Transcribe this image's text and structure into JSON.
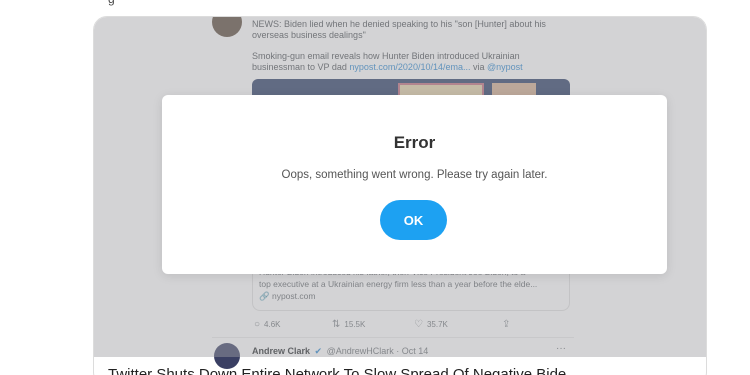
{
  "page": {
    "top_stub": "g",
    "caption": "Twitter Shuts Down Entire Network To Slow Spread Of Negative Bide"
  },
  "tweet": {
    "line1": "NEWS: Biden lied when he denied speaking to his \"son [Hunter] about his",
    "line2": "overseas business dealings\"",
    "line3": "Smoking-gun email reveals how Hunter Biden introduced Ukrainian",
    "line4a": "businessman to VP dad ",
    "line4_link": "nypost.com/2020/10/14/ema...",
    "line4b": " via ",
    "line4_mention": "@nypost",
    "embed_line1": "Hunter Biden introduced his father, then-Vice President Joe Biden, to a",
    "embed_line2": "top executive at a Ukrainian energy firm less than a year before the elde...",
    "embed_site": "nypost.com",
    "replies": "4.6K",
    "retweets": "15.5K",
    "likes": "35.7K",
    "next_author_name": "Andrew Clark",
    "next_author_handle": "@AndrewHClark · Oct 14",
    "more": "···"
  },
  "dialog": {
    "title": "Error",
    "message": "Oops, something went wrong. Please try again later.",
    "ok_label": "OK"
  },
  "colors": {
    "accent": "#1da1f2",
    "overlay": "#aaaaac",
    "link": "#2f84c9"
  }
}
